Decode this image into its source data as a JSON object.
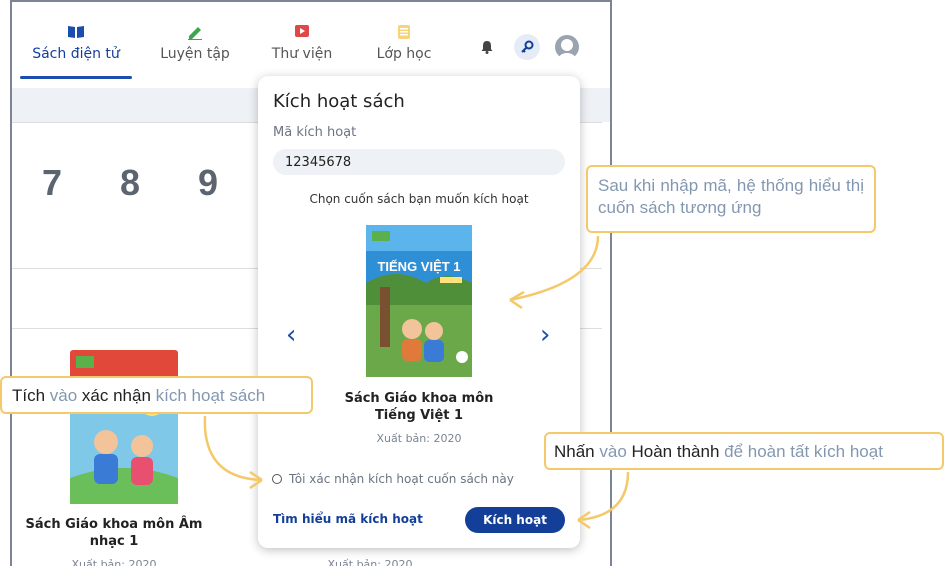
{
  "nav": {
    "tabs": [
      {
        "label": "Sách điện tử",
        "icon": "book-icon",
        "color": "#1b4db0"
      },
      {
        "label": "Luyện tập",
        "icon": "pencil-icon",
        "color": "#3aa84a"
      },
      {
        "label": "Thư viện",
        "icon": "library-icon",
        "color": "#e04848"
      },
      {
        "label": "Lớp học",
        "icon": "class-icon",
        "color": "#f2b84a"
      }
    ],
    "active_tab": 0,
    "icons": [
      "bell-icon",
      "key-icon",
      "avatar"
    ]
  },
  "background": {
    "digits": [
      "7",
      "8",
      "9"
    ],
    "books": [
      {
        "title": "Sách Giáo khoa môn Âm nhạc 1",
        "published": "Xuất bản: 2020"
      },
      {
        "title": "",
        "published": "Xuất bản: 2020"
      }
    ]
  },
  "modal": {
    "title": "Kích hoạt sách",
    "code_label": "Mã kích hoạt",
    "code_value": "12345678",
    "choose_prompt": "Chọn cuốn sách bạn muốn kích hoạt",
    "book_title_line1": "Sách Giáo khoa môn",
    "book_title_line2": "Tiếng Việt 1",
    "published": "Xuất bản: 2020",
    "cover_title": "TIẾNG VIỆT 1",
    "confirm_label": "Tôi xác nhận kích hoạt cuốn sách này",
    "learn_link": "Tìm hiểu mã kích hoạt",
    "activate_button": "Kích hoạt",
    "prev_arrow": "‹",
    "next_arrow": "›"
  },
  "callouts": {
    "top_right": "Sau khi nhập mã, hệ thống hiểu thị cuốn sách tương ứng",
    "left_parts": [
      "Tích",
      " vào ",
      "xác nhận",
      " kích hoạt sách"
    ],
    "bottom_right_parts": [
      "Nhấn",
      " vào ",
      "Hoàn thành",
      " để hoàn tất kích hoạt"
    ]
  },
  "colors": {
    "primary": "#143f99",
    "callout_border": "#f3c96a",
    "muted_text": "#8497b0"
  }
}
